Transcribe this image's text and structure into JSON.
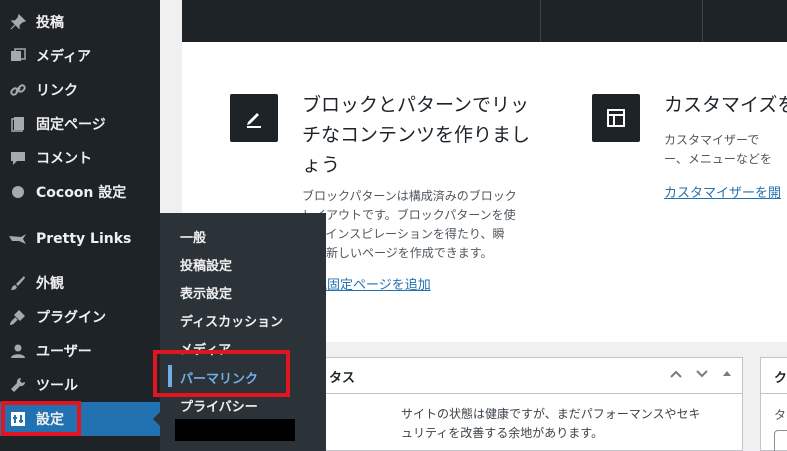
{
  "sidebar": {
    "items": [
      {
        "label": "投稿",
        "icon": "pin-icon"
      },
      {
        "label": "メディア",
        "icon": "media-icon"
      },
      {
        "label": "リンク",
        "icon": "link-icon"
      },
      {
        "label": "固定ページ",
        "icon": "page-icon"
      },
      {
        "label": "コメント",
        "icon": "comment-icon"
      },
      {
        "label": "Cocoon 設定",
        "icon": "circle-icon"
      },
      {
        "label": "Pretty Links",
        "icon": "star-icon"
      },
      {
        "label": "外観",
        "icon": "paintbrush-icon"
      },
      {
        "label": "プラグイン",
        "icon": "plugin-icon"
      },
      {
        "label": "ユーザー",
        "icon": "user-icon"
      },
      {
        "label": "ツール",
        "icon": "wrench-icon"
      },
      {
        "label": "設定",
        "icon": "settings-icon"
      }
    ]
  },
  "submenu": {
    "items": [
      "一般",
      "投稿設定",
      "表示設定",
      "ディスカッション",
      "メディア",
      "パーマリンク",
      "プライバシー"
    ],
    "current": "パーマリンク"
  },
  "welcome": {
    "block": {
      "title": "ブロックとパターンでリッチなコンテンツを作りましょう",
      "title_lines": [
        "ブロックとパターンでリッ",
        "チなコンテンツを作りまし",
        "ょう"
      ],
      "desc_lines": [
        "ブロックパターンは構成済みのブロック",
        "レイアウトです。ブロックパターンを使",
        "ってインスピレーションを得たり、瞬",
        "時に新しいページを作成できます。"
      ],
      "desc_visible": [
        "ブロックパターンは構成済みのブロック",
        "イアウトです。ブロックパターンを使",
        "てインスピレーションを得たり、瞬",
        "新しいページを作成できます。"
      ],
      "link": "規固定ページを追加"
    },
    "customize": {
      "title": "カスタマイズを",
      "desc_lines": [
        "カスタマイザーで",
        "ー、メニューなどを"
      ],
      "link": "カスタマイザーを開"
    }
  },
  "status_panel": {
    "title": "タス",
    "text_lines": [
      "サイトの状態は健康ですが、まだパフォーマンスやセキ",
      "ュリティを改善する余地があります。"
    ]
  },
  "quick_panel": {
    "title": "ク",
    "text": "タ"
  },
  "colors": {
    "sidebar_bg": "#1d2327",
    "active": "#2271b1",
    "highlight": "#e0151f",
    "submenu_current": "#72aee6"
  }
}
